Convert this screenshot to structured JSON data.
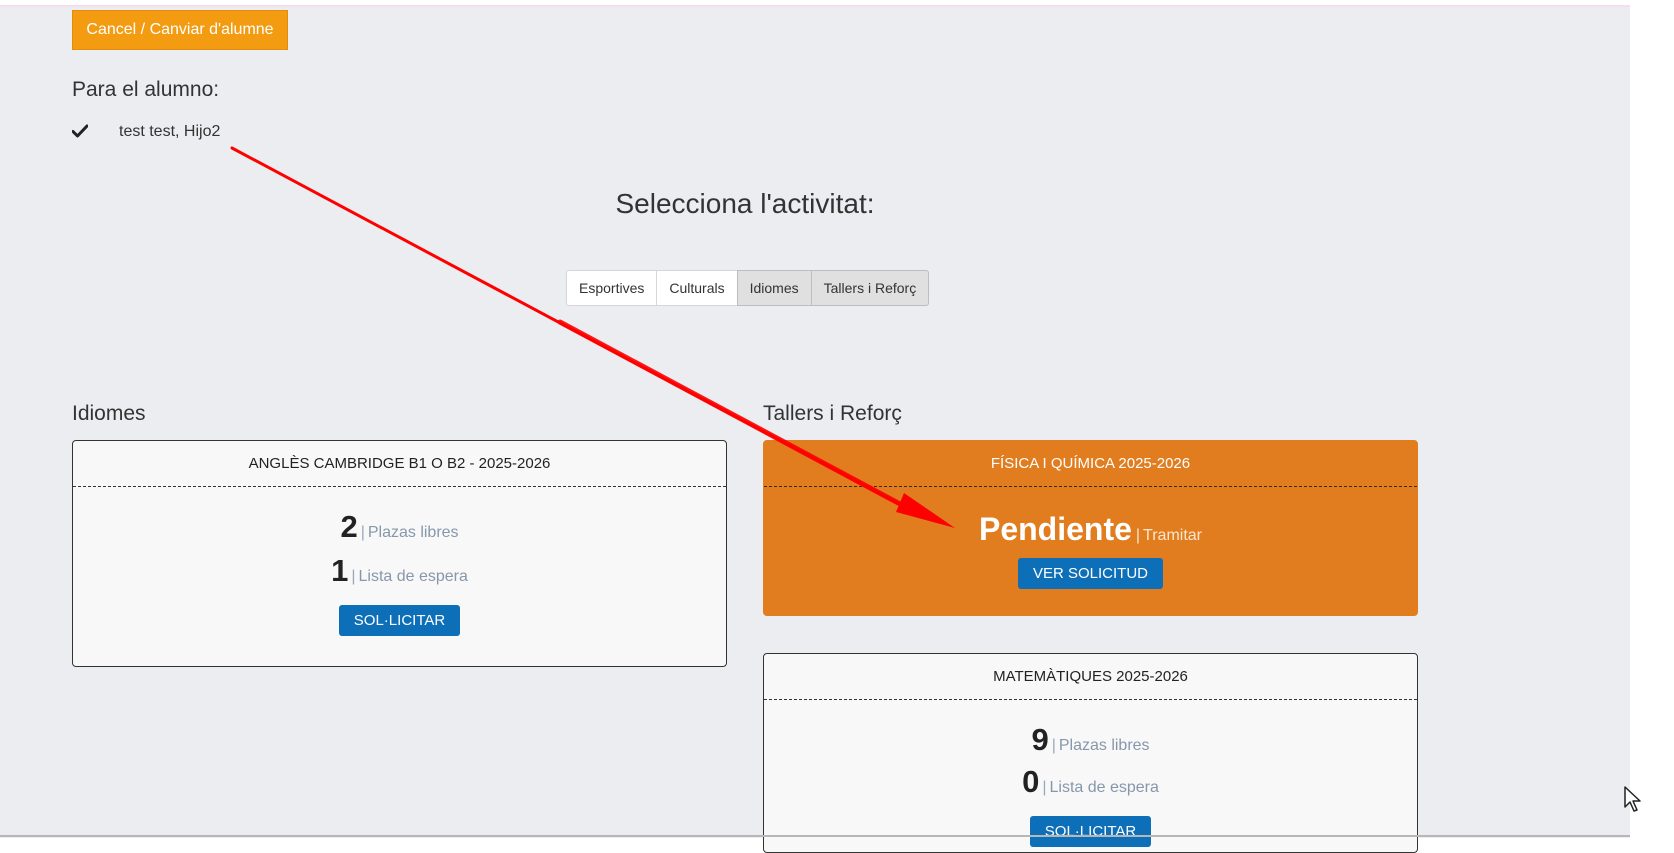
{
  "header": {
    "cancel_label": "Cancel / Canviar d'alumne"
  },
  "student": {
    "heading": "Para el alumno:",
    "name": "test test, Hijo2"
  },
  "activity_selector": {
    "title": "Selecciona l'activitat:",
    "tabs": [
      {
        "label": "Esportives",
        "active": false
      },
      {
        "label": "Culturals",
        "active": false
      },
      {
        "label": "Idiomes",
        "active": true
      },
      {
        "label": "Tallers i Reforç",
        "active": true
      }
    ]
  },
  "sections": {
    "idiomes": {
      "title": "Idiomes",
      "cards": [
        {
          "title": "ANGLÈS CAMBRIDGE B1 O B2 - 2025-2026",
          "free_count": "2",
          "free_label": "Plazas libres",
          "waitlist_count": "1",
          "waitlist_label": "Lista de espera",
          "button_label": "SOL·LICITAR"
        }
      ]
    },
    "tallers": {
      "title": "Tallers i Reforç",
      "cards": [
        {
          "title": "FÍSICA I QUÍMICA 2025-2026",
          "status": "Pendiente",
          "status_action": "Tramitar",
          "button_label": "VER SOLICITUD",
          "highlight_color": "#e27d1f"
        },
        {
          "title": "MATEMÀTIQUES 2025-2026",
          "free_count": "9",
          "free_label": "Plazas libres",
          "waitlist_count": "0",
          "waitlist_label": "Lista de espera",
          "button_label": "SOL·LICITAR"
        }
      ]
    }
  },
  "separator": "|",
  "colors": {
    "accent_orange": "#f39c12",
    "primary_blue": "#0d6fb8",
    "annotation_arrow": "#ff0000"
  }
}
